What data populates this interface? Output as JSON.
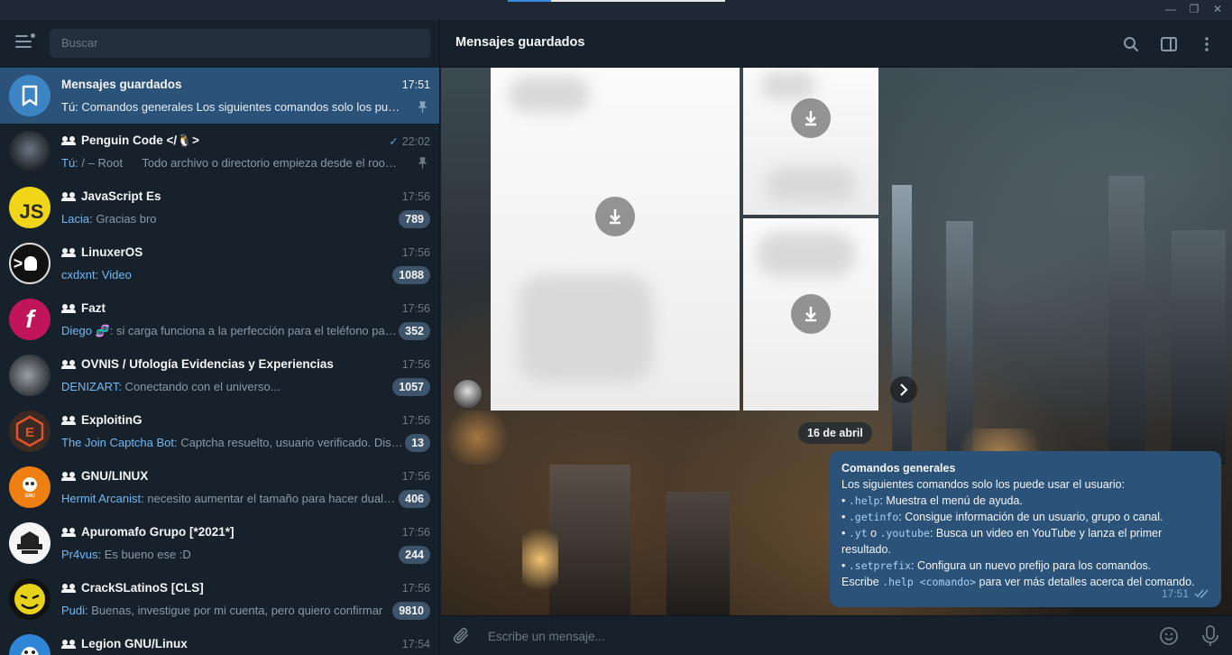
{
  "search": {
    "placeholder": "Buscar"
  },
  "chats": [
    {
      "name": "Mensajes guardados",
      "time": "17:51",
      "sender": "Tú:",
      "text": " Comandos generales Los siguientes comandos solo los puede usar el usuario:",
      "pinned": true,
      "group": false,
      "active": true
    },
    {
      "name": "Penguin Code </🐧>",
      "time": "22:02",
      "sender": "Tú:",
      "text": " / – Root      Todo archivo o directorio empieza desde el root del sistema",
      "pinned": true,
      "group": true,
      "read": true
    },
    {
      "name": "JavaScript Es",
      "time": "17:56",
      "sender": "Lacia:",
      "text": " Gracias bro",
      "badge": "789",
      "group": true
    },
    {
      "name": "LinuxerOS",
      "time": "17:56",
      "sender": "cxdxnt: Video",
      "text": "",
      "badge": "1088",
      "group": true
    },
    {
      "name": "Fazt",
      "time": "17:56",
      "sender": "Diego 🧬",
      "text": ": si carga funciona a la perfección para el teléfono pantalla",
      "badge": "352",
      "group": true
    },
    {
      "name": "OVNIS / Ufología Evidencias y Experiencias",
      "time": "17:56",
      "sender": "DENIZART:",
      "text": " Conectando con el universo...",
      "badge": "1057",
      "group": true
    },
    {
      "name": "ExploitinG",
      "time": "17:56",
      "sender": "The Join Captcha Bot:",
      "text": " Captcha resuelto, usuario verificado. Disfruta",
      "badge": "13",
      "group": true
    },
    {
      "name": "GNU/LINUX",
      "time": "17:56",
      "sender": "Hermit Arcanist:",
      "text": " necesito aumentar el tamaño para hacer dual boot",
      "badge": "406",
      "group": true
    },
    {
      "name": "Apuromafo Grupo [*2021*]",
      "time": "17:56",
      "sender": "Pr4vus:",
      "text": " Es bueno ese :D",
      "badge": "244",
      "group": true
    },
    {
      "name": "CrackSLatinoS [CLS]",
      "time": "17:56",
      "sender": "Pudi:",
      "text": " Buenas, investigue por mi cuenta, pero quiero confirmar",
      "badge": "9810",
      "group": true
    },
    {
      "name": "Legion GNU/Linux",
      "time": "17:54",
      "sender": "",
      "text": "",
      "group": true
    }
  ],
  "main": {
    "title": "Mensajes guardados",
    "date": "16 de abril",
    "message": {
      "title": "Comandos generales",
      "intro": "Los siguientes comandos solo los puede usar el usuario:",
      "l1_cmd": ".help",
      "l1_text": ": Muestra el menú de ayuda.",
      "l2_cmd": ".getinfo",
      "l2_text": ": Consigue información de un usuario, grupo o canal.",
      "l3_cmd": ".yt",
      "l3_mid": " o ",
      "l3_cmd2": ".youtube",
      "l3_text": ": Busca un video en YouTube y lanza el primer resultado.",
      "l4_cmd": ".setprefix",
      "l4_text": ": Configura un nuevo prefijo para los comandos.",
      "l5_pre": "Escribe ",
      "l5_cmd": ".help <comando>",
      "l5_text": " para ver más detalles acerca del comando.",
      "time": "17:51"
    },
    "composer_placeholder": "Escribe un mensaje..."
  },
  "colors": {
    "accent": "#2b5278",
    "sidebar": "#17212b",
    "link": "#71b8f4",
    "badge": "#3e546a"
  }
}
